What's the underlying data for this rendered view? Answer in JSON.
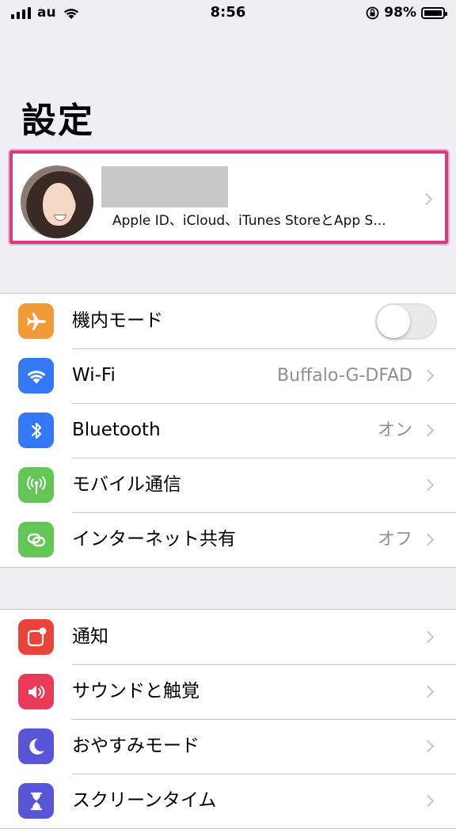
{
  "status_bar": {
    "carrier": "au",
    "time": "8:56",
    "battery": "98%",
    "battery_level": 0.98,
    "icons": [
      "signal-icon",
      "wifi-icon",
      "orientation-lock-icon",
      "battery-icon"
    ]
  },
  "title": "設定",
  "profile": {
    "subtitle": "Apple ID、iCloud、iTunes StoreとApp S..."
  },
  "group1": {
    "rows": [
      {
        "label": "機内モード",
        "icon": "airplane-icon",
        "color": "#f19a38",
        "toggle_on": false
      },
      {
        "label": "Wi-Fi",
        "value": "Buffalo-G-DFAD",
        "icon": "wifi-icon",
        "color": "#3478f6"
      },
      {
        "label": "Bluetooth",
        "value": "オン",
        "icon": "bluetooth-icon",
        "color": "#3478f6"
      },
      {
        "label": "モバイル通信",
        "icon": "antenna-icon",
        "color": "#63c555"
      },
      {
        "label": "インターネット共有",
        "value": "オフ",
        "icon": "link-icon",
        "color": "#63c555"
      }
    ]
  },
  "group2": {
    "rows": [
      {
        "label": "通知",
        "icon": "notification-icon",
        "color": "#e9443a"
      },
      {
        "label": "サウンドと触覚",
        "icon": "speaker-icon",
        "color": "#ea3a5a"
      },
      {
        "label": "おやすみモード",
        "icon": "moon-icon",
        "color": "#5856d6"
      },
      {
        "label": "スクリーンタイム",
        "icon": "hourglass-icon",
        "color": "#5856d6"
      }
    ]
  }
}
